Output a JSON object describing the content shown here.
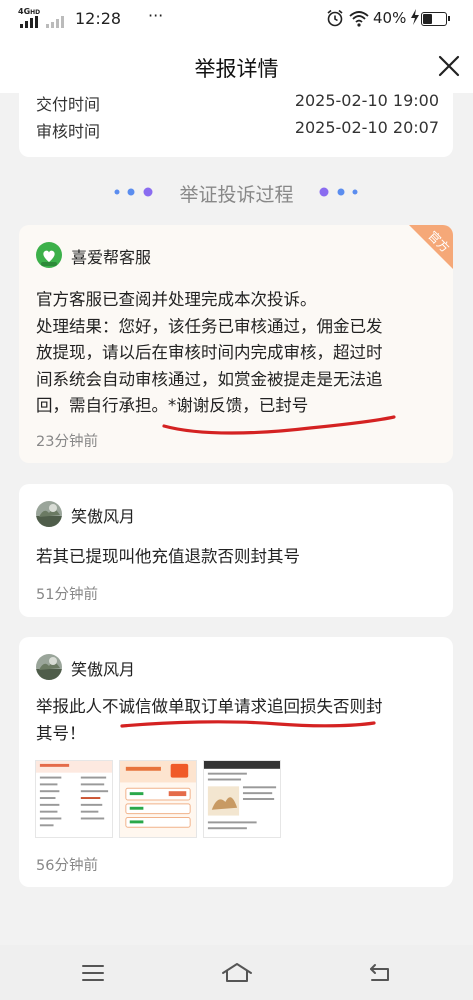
{
  "status": {
    "network": "4G",
    "network_sub": "HD",
    "time": "12:28",
    "more": "···",
    "battery_text": "40%",
    "battery_level": 0.4,
    "icons": [
      "signal-icon",
      "alarm-icon",
      "wifi-icon",
      "charging-icon",
      "battery-icon"
    ]
  },
  "header": {
    "title": "举报详情",
    "close_icon": "close-icon"
  },
  "info": {
    "rows": [
      {
        "label": "交付时间",
        "value": "2025-02-10 19:00"
      },
      {
        "label": "审核时间",
        "value": "2025-02-10 20:07"
      }
    ]
  },
  "section": {
    "title": "举证投诉过程"
  },
  "records": [
    {
      "author": "喜爱帮客服",
      "badge": "官方",
      "lines": [
        "官方客服已查阅并处理完成本次投诉。",
        "处理结果：您好，该任务已审核通过，佣金已发",
        "放提现，请以后在审核时间内完成审核，超过时",
        "间系统会自动审核通过，如赏金被提走是无法追",
        "回，需自行承担。*谢谢反馈，已封号"
      ],
      "time": "23分钟前"
    },
    {
      "author": "笑傲风月",
      "lines": [
        "若其已提现叫他充值退款否则封其号"
      ],
      "time": "51分钟前"
    },
    {
      "author": "笑傲风月",
      "lines": [
        "举报此人不诚信做单取订单请求追回损失否则封",
        "其号！"
      ],
      "time": "56分钟前"
    }
  ],
  "colors": {
    "accent_purple": "#8a6cf0",
    "accent_blue": "#5b8def",
    "official_orange": "#f5a878",
    "annotation_red": "#d42222"
  },
  "bottom_nav": [
    "menu-icon",
    "home-icon",
    "back-icon"
  ]
}
